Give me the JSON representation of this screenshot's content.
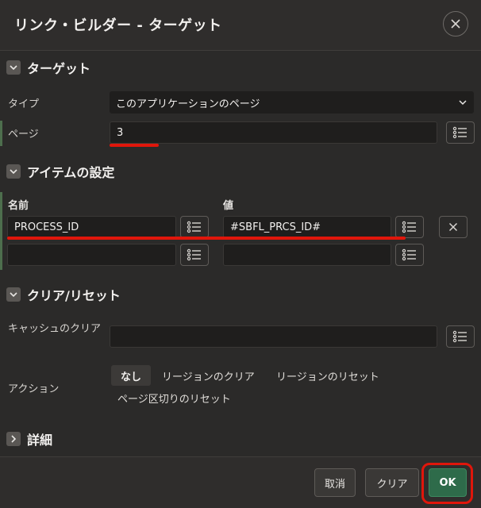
{
  "dialog": {
    "title": "リンク・ビルダー - ターゲット",
    "close_icon": "close-icon"
  },
  "target_section": {
    "title": "ターゲット",
    "type_label": "タイプ",
    "type_value": "このアプリケーションのページ",
    "page_label": "ページ",
    "page_value": "3"
  },
  "items_section": {
    "title": "アイテムの設定",
    "name_header": "名前",
    "value_header": "値",
    "rows": [
      {
        "name": "PROCESS_ID",
        "value": "#SBFL_PRCS_ID#"
      },
      {
        "name": "",
        "value": ""
      }
    ]
  },
  "clear_section": {
    "title": "クリア/リセット",
    "clear_cache_label": "キャッシュのクリア",
    "clear_cache_value": "",
    "action_label": "アクション",
    "actions": [
      "なし",
      "リージョンのクリア",
      "リージョンのリセット",
      "ページ区切りのリセット"
    ],
    "selected_action": "なし"
  },
  "details_section": {
    "title": "詳細"
  },
  "footer": {
    "cancel_label": "取消",
    "clear_label": "クリア",
    "ok_label": "OK"
  },
  "colors": {
    "accent_green": "#2e6b4a",
    "highlight_red": "#e0160b",
    "background": "#2b2a29",
    "field_bg": "#1f1e1d"
  }
}
